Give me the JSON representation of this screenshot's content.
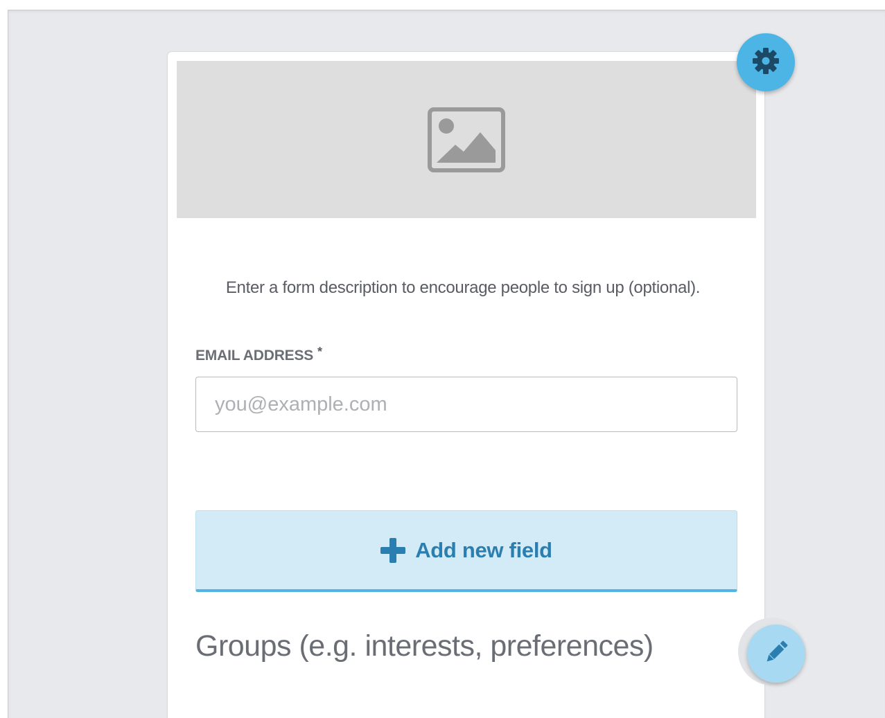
{
  "form": {
    "description": "Enter a form description to encourage people to sign up (optional).",
    "email_field": {
      "label": "EMAIL ADDRESS",
      "required_mark": "*",
      "placeholder": "you@example.com"
    },
    "add_field_button": {
      "label": "Add new field"
    },
    "groups_heading": "Groups (e.g. interests, preferences)"
  },
  "icons": {
    "image_placeholder": "image-icon",
    "settings": "gear-icon",
    "edit": "pencil-icon",
    "add": "plus-icon"
  },
  "colors": {
    "accent": "#4cb5e5",
    "button_bg": "#d2ebf7",
    "button_text": "#2a7fb0",
    "canvas_bg": "#e8e9ec",
    "placeholder_bg": "#dedede"
  }
}
